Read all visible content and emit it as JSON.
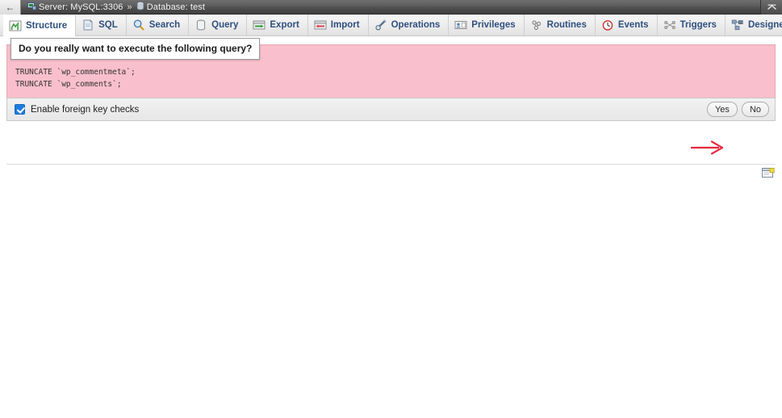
{
  "window": {
    "back_icon": "back-arrow-icon",
    "server_icon": "server-icon",
    "server_label": "Server: MySQL:3306",
    "separator": "»",
    "database_icon": "database-icon",
    "database_label": "Database: test",
    "collapse_icon": "chevron-up-icon"
  },
  "tabs": [
    {
      "label": "Structure",
      "icon": "structure-icon",
      "active": true
    },
    {
      "label": "SQL",
      "icon": "sql-icon",
      "active": false
    },
    {
      "label": "Search",
      "icon": "search-icon",
      "active": false
    },
    {
      "label": "Query",
      "icon": "query-icon",
      "active": false
    },
    {
      "label": "Export",
      "icon": "export-icon",
      "active": false
    },
    {
      "label": "Import",
      "icon": "import-icon",
      "active": false
    },
    {
      "label": "Operations",
      "icon": "operations-icon",
      "active": false
    },
    {
      "label": "Privileges",
      "icon": "privileges-icon",
      "active": false
    },
    {
      "label": "Routines",
      "icon": "routines-icon",
      "active": false
    },
    {
      "label": "Events",
      "icon": "events-icon",
      "active": false
    },
    {
      "label": "Triggers",
      "icon": "triggers-icon",
      "active": false
    },
    {
      "label": "Designer",
      "icon": "designer-icon",
      "active": false
    }
  ],
  "confirm": {
    "question": "Do you really want to execute the following query?",
    "sql_lines": [
      "TRUNCATE `wp_commentmeta`;",
      "TRUNCATE `wp_comments`;"
    ],
    "panel_color": "#f9bfcc",
    "foreign_key_label": "Enable foreign key checks",
    "foreign_key_checked": true,
    "yes_label": "Yes",
    "no_label": "No",
    "arrow_color": "#e8293f",
    "arrow_target": "Yes"
  },
  "console": {
    "icon": "console-window-icon"
  }
}
